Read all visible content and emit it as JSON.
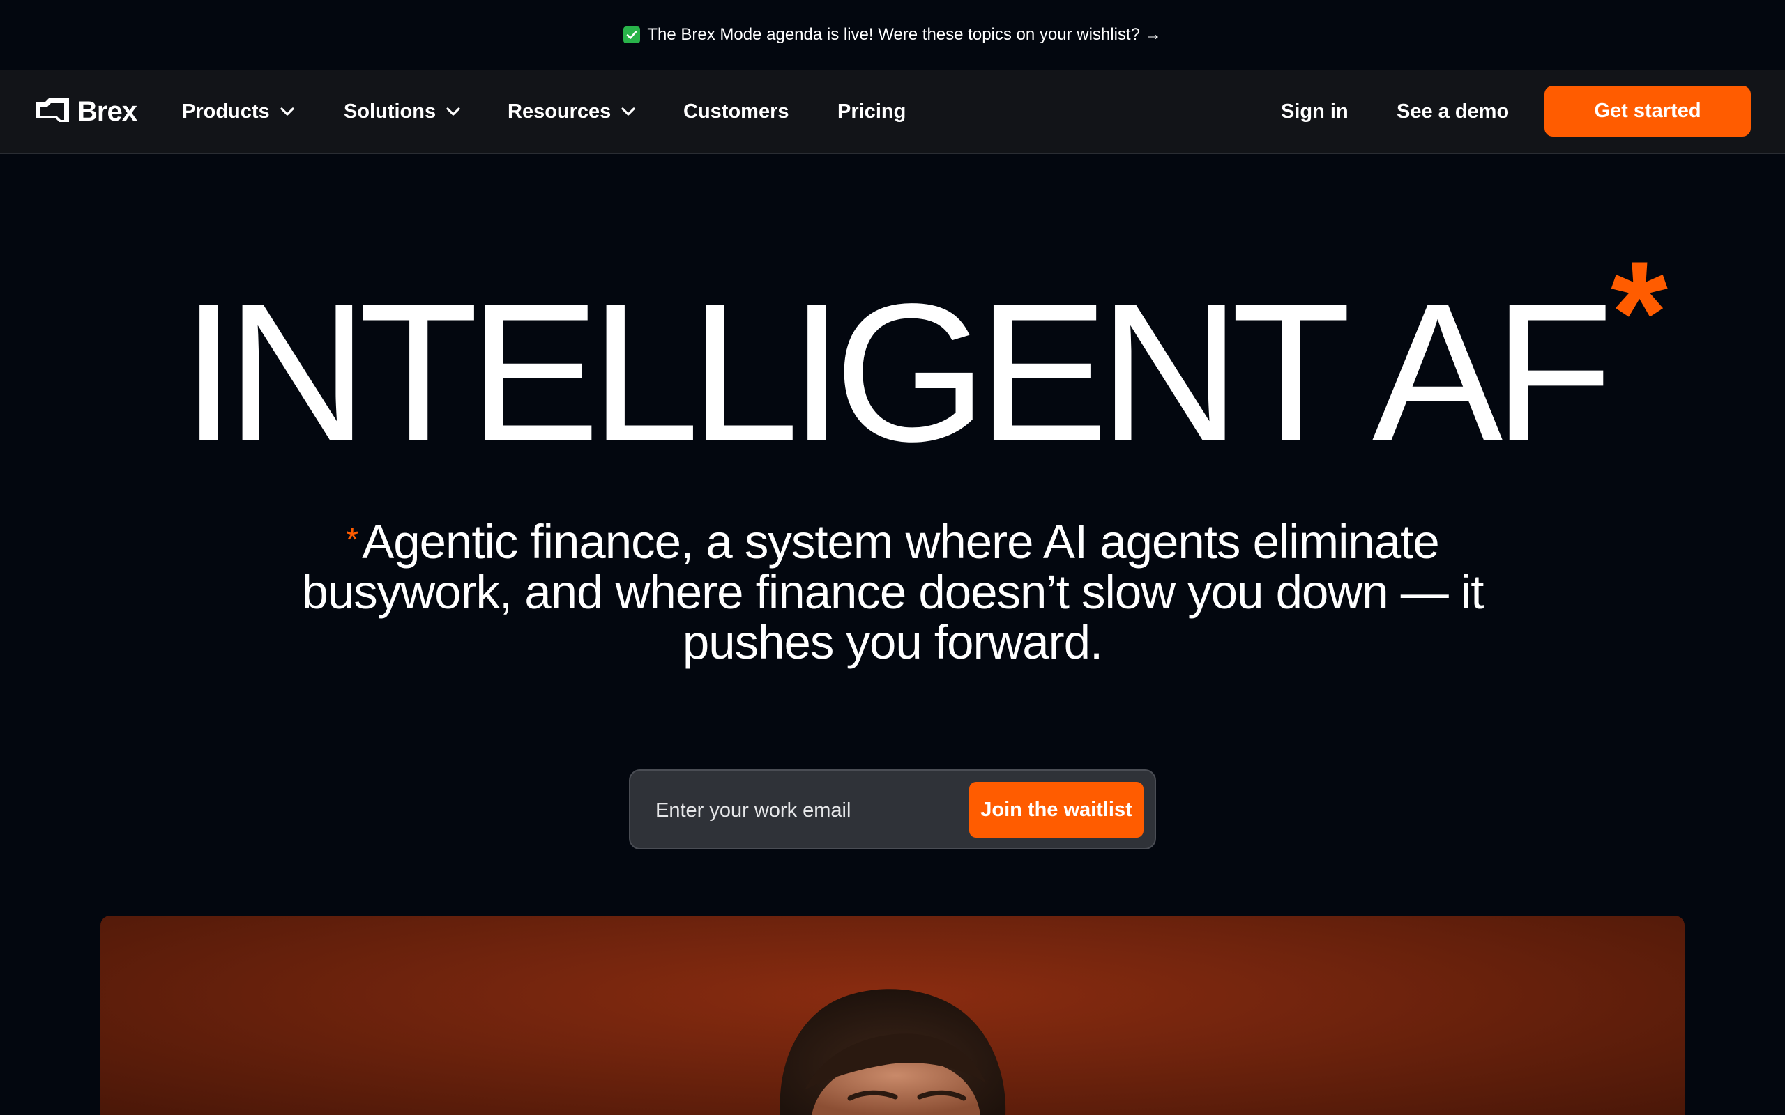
{
  "announcement": {
    "check_icon": "check-box-icon",
    "text": "The Brex Mode agenda is live! Were these topics on your wishlist? →"
  },
  "navbar": {
    "logo_text": "Brex",
    "items": [
      {
        "label": "Products",
        "has_dropdown": true
      },
      {
        "label": "Solutions",
        "has_dropdown": true
      },
      {
        "label": "Resources",
        "has_dropdown": true
      },
      {
        "label": "Customers",
        "has_dropdown": false
      },
      {
        "label": "Pricing",
        "has_dropdown": false
      }
    ],
    "sign_in": "Sign in",
    "demo": "See a demo",
    "get_started": "Get started"
  },
  "hero": {
    "title": "INTELLIGENT AF",
    "title_asterisk": "*",
    "sub_asterisk": "*",
    "subtitle": "Agentic finance, a system where AI agents eliminate busywork, and where finance doesn’t slow you down — it pushes you forward."
  },
  "waitlist": {
    "placeholder": "Enter your work email",
    "button": "Join the waitlist"
  },
  "colors": {
    "accent": "#ff5c00",
    "background": "#03070f",
    "navbar": "#121418",
    "input_bg": "#2f3238",
    "check_green": "#29b34a"
  }
}
